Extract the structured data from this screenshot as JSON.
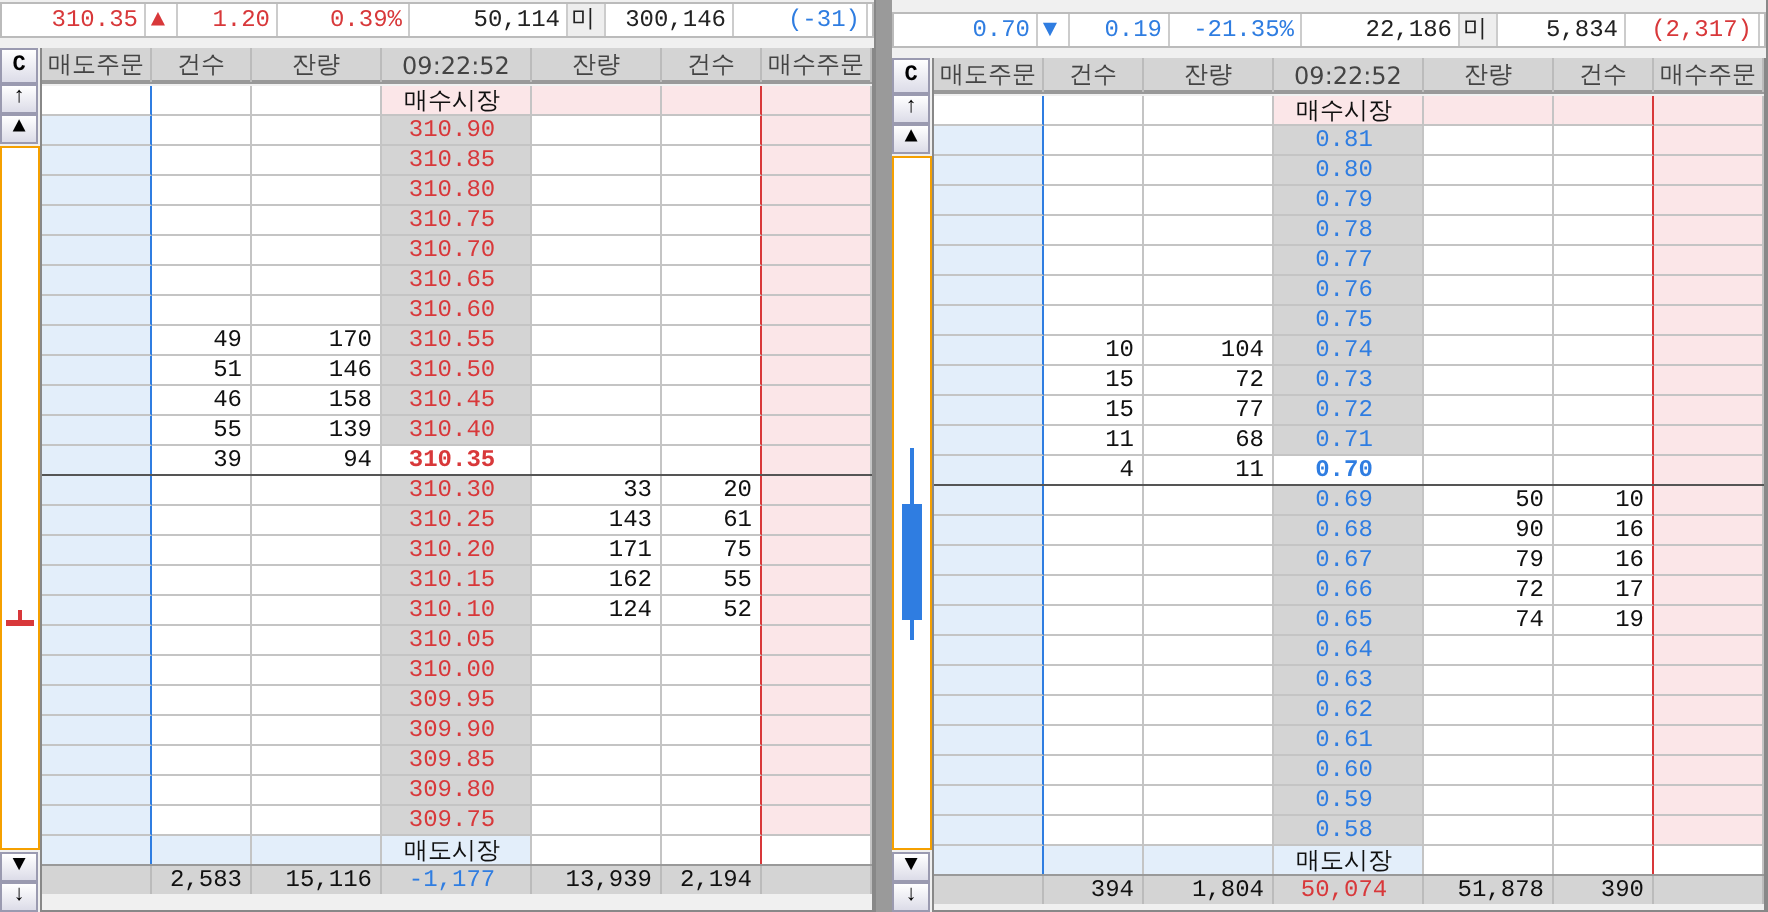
{
  "panels": [
    {
      "color": "#d8383a",
      "chart": {
        "kind": "tick"
      },
      "summary": {
        "price": "310.35",
        "arrow": "▲",
        "change": "1.20",
        "rate": "0.39%",
        "volume": "50,114",
        "unit": "미",
        "amount": "300,146",
        "diff": {
          "text": "(-31)",
          "color": "#2f7de1"
        }
      },
      "buttons": {
        "clear": "C",
        "top": "↑",
        "up": "▲",
        "down": "▼",
        "bottom": "↓"
      },
      "columns": [
        "매도주문",
        "건수",
        "잔량",
        "09:22:52",
        "잔량",
        "건수",
        "매수주문"
      ],
      "buy_market": "매수시장",
      "sell_market": "매도시장",
      "levels": [
        {
          "price": "310.90",
          "current": false
        },
        {
          "price": "310.85",
          "current": false
        },
        {
          "price": "310.80",
          "current": false
        },
        {
          "price": "310.75",
          "current": false
        },
        {
          "price": "310.70",
          "current": false
        },
        {
          "price": "310.65",
          "current": false
        },
        {
          "price": "310.60",
          "current": false
        },
        {
          "price": "310.55",
          "ask_count": "49",
          "ask_qty": "170",
          "current": false
        },
        {
          "price": "310.50",
          "ask_count": "51",
          "ask_qty": "146",
          "current": false
        },
        {
          "price": "310.45",
          "ask_count": "46",
          "ask_qty": "158",
          "current": false
        },
        {
          "price": "310.40",
          "ask_count": "55",
          "ask_qty": "139",
          "current": false
        },
        {
          "price": "310.35",
          "ask_count": "39",
          "ask_qty": "94",
          "current": true
        },
        {
          "price": "310.30",
          "bid_qty": "33",
          "bid_count": "20",
          "current": false
        },
        {
          "price": "310.25",
          "bid_qty": "143",
          "bid_count": "61",
          "current": false
        },
        {
          "price": "310.20",
          "bid_qty": "171",
          "bid_count": "75",
          "current": false
        },
        {
          "price": "310.15",
          "bid_qty": "162",
          "bid_count": "55",
          "current": false
        },
        {
          "price": "310.10",
          "bid_qty": "124",
          "bid_count": "52",
          "current": false
        },
        {
          "price": "310.05",
          "current": false
        },
        {
          "price": "310.00",
          "current": false
        },
        {
          "price": "309.95",
          "current": false
        },
        {
          "price": "309.90",
          "current": false
        },
        {
          "price": "309.85",
          "current": false
        },
        {
          "price": "309.80",
          "current": false
        },
        {
          "price": "309.75",
          "current": false
        }
      ],
      "totals": {
        "ask_count": "2,583",
        "ask_qty": "15,116",
        "net": {
          "text": "-1,177",
          "color": "#2f7de1"
        },
        "bid_qty": "13,939",
        "bid_count": "2,194"
      }
    },
    {
      "color": "#2f7de1",
      "chart": {
        "kind": "candle"
      },
      "summary": {
        "price": "0.70",
        "arrow": "▼",
        "change": "0.19",
        "rate": "-21.35%",
        "volume": "22,186",
        "unit": "미",
        "amount": "5,834",
        "diff": {
          "text": "(2,317)",
          "color": "#d8383a"
        }
      },
      "buttons": {
        "clear": "C",
        "top": "↑",
        "up": "▲",
        "down": "▼",
        "bottom": "↓"
      },
      "columns": [
        "매도주문",
        "건수",
        "잔량",
        "09:22:52",
        "잔량",
        "건수",
        "매수주문"
      ],
      "buy_market": "매수시장",
      "sell_market": "매도시장",
      "levels": [
        {
          "price": "0.81",
          "current": false
        },
        {
          "price": "0.80",
          "current": false
        },
        {
          "price": "0.79",
          "current": false
        },
        {
          "price": "0.78",
          "current": false
        },
        {
          "price": "0.77",
          "current": false
        },
        {
          "price": "0.76",
          "current": false
        },
        {
          "price": "0.75",
          "current": false
        },
        {
          "price": "0.74",
          "ask_count": "10",
          "ask_qty": "104",
          "current": false
        },
        {
          "price": "0.73",
          "ask_count": "15",
          "ask_qty": "72",
          "current": false
        },
        {
          "price": "0.72",
          "ask_count": "15",
          "ask_qty": "77",
          "current": false
        },
        {
          "price": "0.71",
          "ask_count": "11",
          "ask_qty": "68",
          "current": false
        },
        {
          "price": "0.70",
          "ask_count": "4",
          "ask_qty": "11",
          "current": true
        },
        {
          "price": "0.69",
          "bid_qty": "50",
          "bid_count": "10",
          "current": false
        },
        {
          "price": "0.68",
          "bid_qty": "90",
          "bid_count": "16",
          "current": false
        },
        {
          "price": "0.67",
          "bid_qty": "79",
          "bid_count": "16",
          "current": false
        },
        {
          "price": "0.66",
          "bid_qty": "72",
          "bid_count": "17",
          "current": false
        },
        {
          "price": "0.65",
          "bid_qty": "74",
          "bid_count": "19",
          "current": false
        },
        {
          "price": "0.64",
          "current": false
        },
        {
          "price": "0.63",
          "current": false
        },
        {
          "price": "0.62",
          "current": false
        },
        {
          "price": "0.61",
          "current": false
        },
        {
          "price": "0.60",
          "current": false
        },
        {
          "price": "0.59",
          "current": false
        },
        {
          "price": "0.58",
          "current": false
        }
      ],
      "totals": {
        "ask_count": "394",
        "ask_qty": "1,804",
        "net": {
          "text": "50,074",
          "color": "#d8383a"
        },
        "bid_qty": "51,878",
        "bid_count": "390"
      }
    }
  ]
}
